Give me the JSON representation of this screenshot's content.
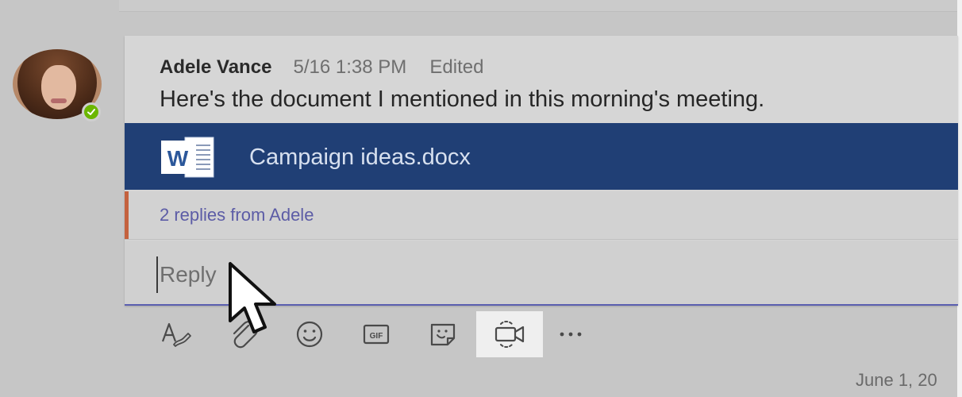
{
  "message": {
    "author": "Adele Vance",
    "timestamp": "5/16 1:38 PM",
    "status": "Edited",
    "text": "Here's the document I mentioned in this morning's meeting.",
    "presence_color": "#6bb700"
  },
  "attachment": {
    "icon": "word-document-icon",
    "name": "Campaign ideas.docx",
    "background_color": "#203f75"
  },
  "thread": {
    "replies_label": "2 replies from Adele",
    "accent_color": "#c4623f"
  },
  "reply": {
    "placeholder": "Reply",
    "underline_color": "#5b5fb0"
  },
  "toolbar": {
    "tools": [
      {
        "icon": "format-icon",
        "name": "Format"
      },
      {
        "icon": "attach-icon",
        "name": "Attach"
      },
      {
        "icon": "emoji-icon",
        "name": "Emoji"
      },
      {
        "icon": "gif-icon",
        "name": "Giphy",
        "label": "GIF"
      },
      {
        "icon": "sticker-icon",
        "name": "Sticker"
      },
      {
        "icon": "meet-now-icon",
        "name": "Meet now",
        "active": true
      },
      {
        "icon": "more-options-icon",
        "name": "More options"
      }
    ]
  },
  "footer": {
    "date_label": "June 1, 20"
  }
}
